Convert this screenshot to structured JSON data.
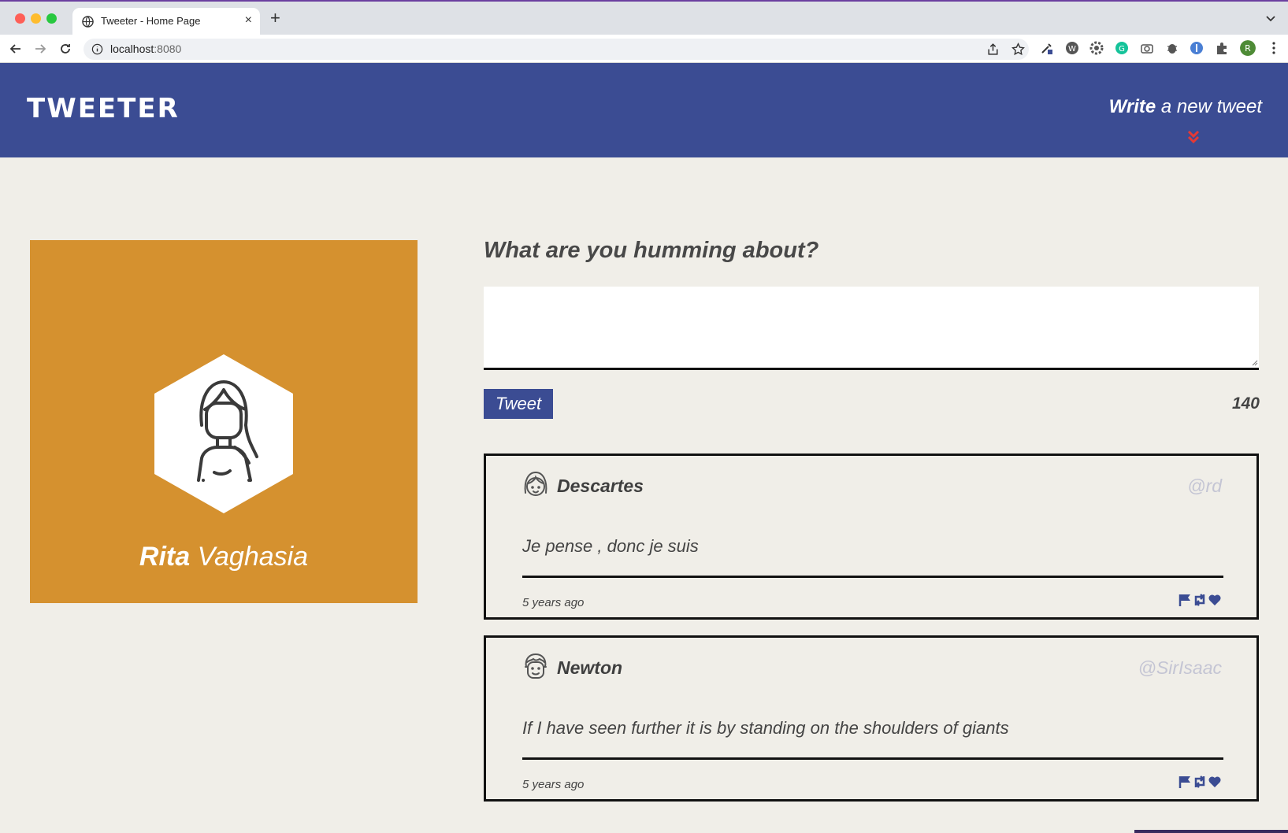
{
  "browser": {
    "tab_title": "Tweeter - Home Page",
    "url_host": "localhost",
    "url_port": ":8080",
    "new_tab_label": "+",
    "tab_close_label": "×",
    "profile_initial": "R"
  },
  "header": {
    "logo": "TWEETER",
    "compose_strong": "Write",
    "compose_rest": " a new tweet",
    "colors": {
      "bar": "#3b4c93",
      "chevron": "#e53935"
    }
  },
  "profile": {
    "first_name": "Rita",
    "last_name": "Vaghasia",
    "card_color": "#d5912f"
  },
  "compose": {
    "title": "What are you humming about?",
    "textarea_value": "",
    "button_label": "Tweet",
    "char_count": "140"
  },
  "tweets": [
    {
      "name": "Descartes",
      "handle": "@rd",
      "body": "Je pense , donc je suis",
      "time": "5 years ago",
      "avatar": "girl-avatar-icon"
    },
    {
      "name": "Newton",
      "handle": "@SirIsaac",
      "body": "If I have seen further it is by standing on the shoulders of giants",
      "time": "5 years ago",
      "avatar": "boy-avatar-icon"
    }
  ]
}
